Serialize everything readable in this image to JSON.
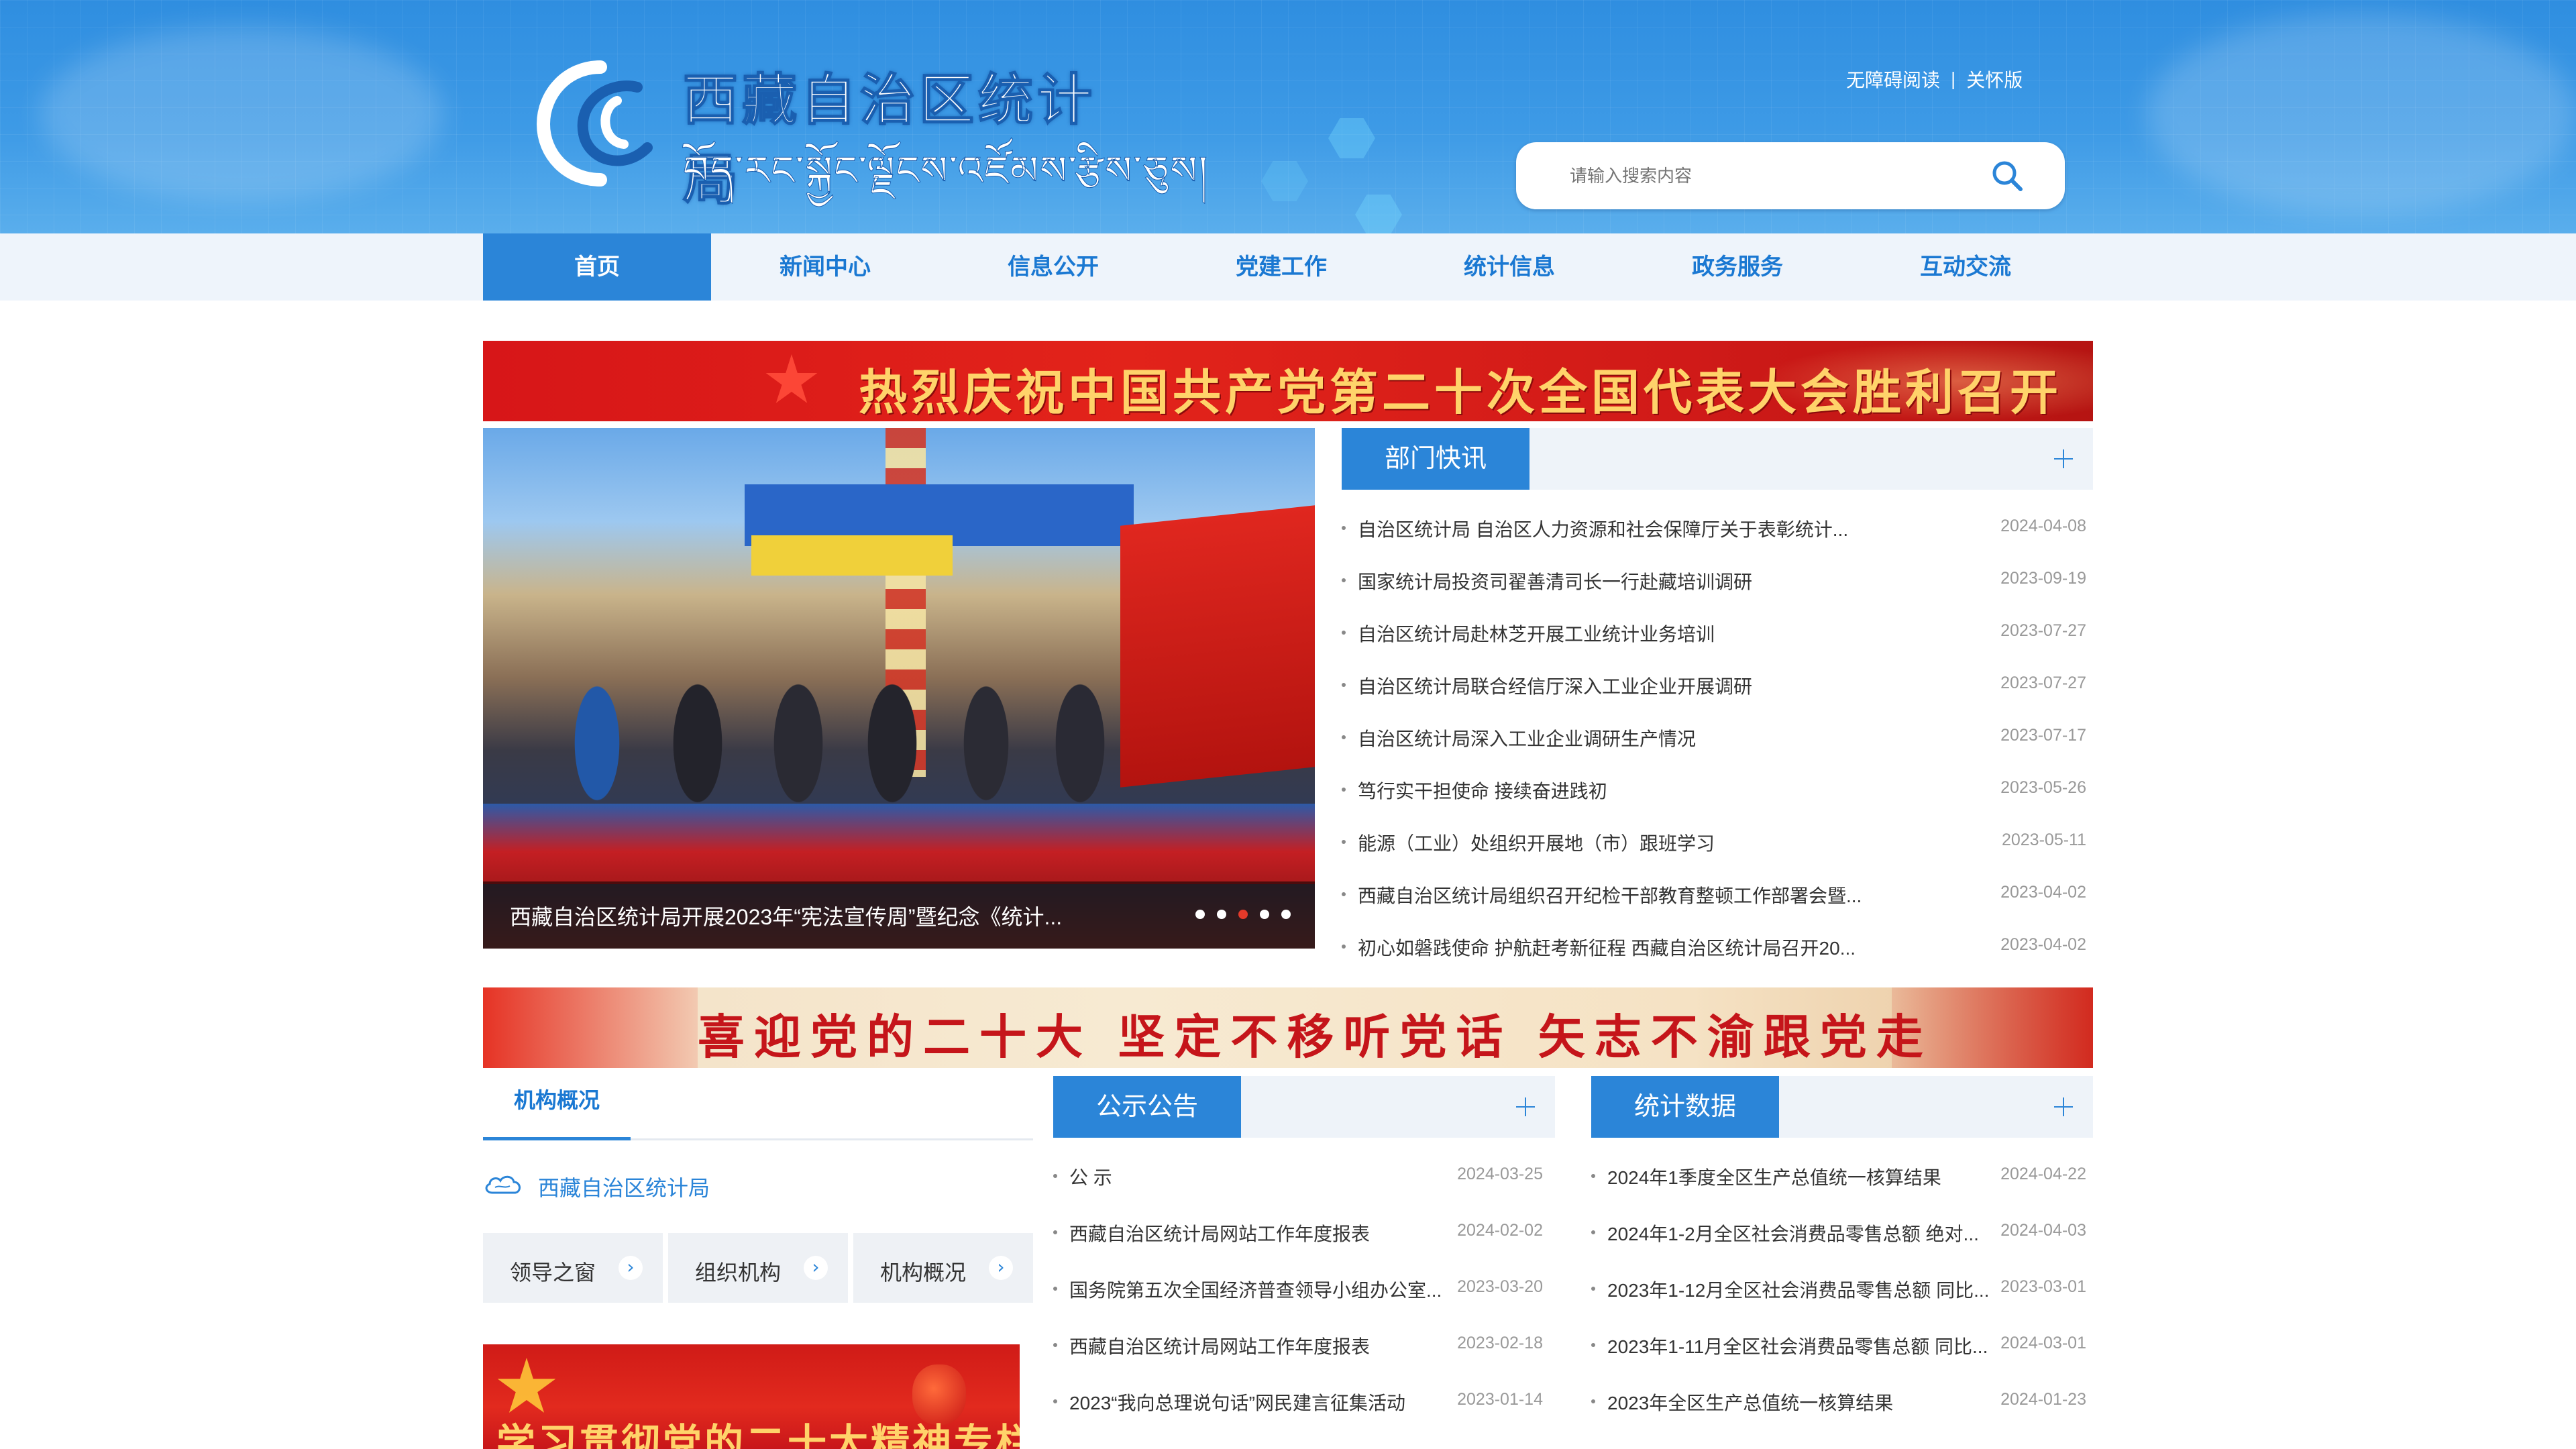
{
  "header": {
    "title_cn": "西藏自治区统计局",
    "title_tibetan": "བོད་རང་སྐྱོང་ལྗོངས་འཛོམས་རྩིས་ཅུས།",
    "links": [
      "无障碍阅读",
      "关怀版"
    ],
    "link_separator": "|",
    "search_placeholder": "请输入搜索内容"
  },
  "nav": {
    "items": [
      "首页",
      "新闻中心",
      "信息公开",
      "党建工作",
      "统计信息",
      "政务服务",
      "互动交流"
    ]
  },
  "banner1": {
    "text": "热烈庆祝中国共产党第二十次全国代表大会胜利召开"
  },
  "banner2": {
    "text": "喜迎党的二十大  坚定不移听党话  矢志不渝跟党走"
  },
  "slider": {
    "caption": "西藏自治区统计局开展2023年“宪法宣传周”暨纪念《统计...",
    "dot_count": 5,
    "active_dot": 2
  },
  "dept_news": {
    "title": "部门快讯",
    "items": [
      {
        "title": "自治区统计局 自治区人力资源和社会保障厅关于表彰统计...",
        "date": "2024-04-08"
      },
      {
        "title": "国家统计局投资司翟善清司长一行赴藏培训调研",
        "date": "2023-09-19"
      },
      {
        "title": "自治区统计局赴林芝开展工业统计业务培训",
        "date": "2023-07-27"
      },
      {
        "title": "自治区统计局联合经信厅深入工业企业开展调研",
        "date": "2023-07-27"
      },
      {
        "title": "自治区统计局深入工业企业调研生产情况",
        "date": "2023-07-17"
      },
      {
        "title": "笃行实干担使命 接续奋进践初",
        "date": "2023-05-26"
      },
      {
        "title": "能源（工业）处组织开展地（市）跟班学习",
        "date": "2023-05-11"
      },
      {
        "title": "西藏自治区统计局组织召开纪检干部教育整顿工作部署会暨...",
        "date": "2023-04-02"
      },
      {
        "title": "初心如磐践使命 护航赶考新征程 西藏自治区统计局召开20...",
        "date": "2023-04-02"
      }
    ]
  },
  "org": {
    "tab": "机构概况",
    "name": "西藏自治区统计局",
    "buttons": [
      "领导之窗",
      "组织机构",
      "机构概况"
    ]
  },
  "notice": {
    "title": "公示公告",
    "items": [
      {
        "title": "公 示",
        "date": "2024-03-25"
      },
      {
        "title": "西藏自治区统计局网站工作年度报表",
        "date": "2024-02-02"
      },
      {
        "title": "国务院第五次全国经济普查领导小组办公室...",
        "date": "2023-03-20"
      },
      {
        "title": "西藏自治区统计局网站工作年度报表",
        "date": "2023-02-18"
      },
      {
        "title": "2023“我向总理说句话”网民建言征集活动",
        "date": "2023-01-14"
      }
    ]
  },
  "stats": {
    "title": "统计数据",
    "items": [
      {
        "title": "2024年1季度全区生产总值统一核算结果",
        "date": "2024-04-22"
      },
      {
        "title": "2024年1-2月全区社会消费品零售总额 绝对...",
        "date": "2024-04-03"
      },
      {
        "title": "2023年1-12月全区社会消费品零售总额 同比...",
        "date": "2023-03-01"
      },
      {
        "title": "2023年1-11月全区社会消费品零售总额 同比...",
        "date": "2024-03-01"
      },
      {
        "title": "2023年全区生产总值统一核算结果",
        "date": "2024-01-23"
      }
    ]
  },
  "study_banner": {
    "text": "学习贯彻党的二十大精神专栏"
  },
  "colors": {
    "primary": "#2b85d8",
    "header_bg": "#3d9ae6",
    "nav_bg": "#eef4fb",
    "red": "#d71618"
  },
  "icons": {
    "search": "search-icon",
    "plus": "plus-icon",
    "arrow": "chevron-right-icon",
    "cloud": "cloud-icon"
  }
}
